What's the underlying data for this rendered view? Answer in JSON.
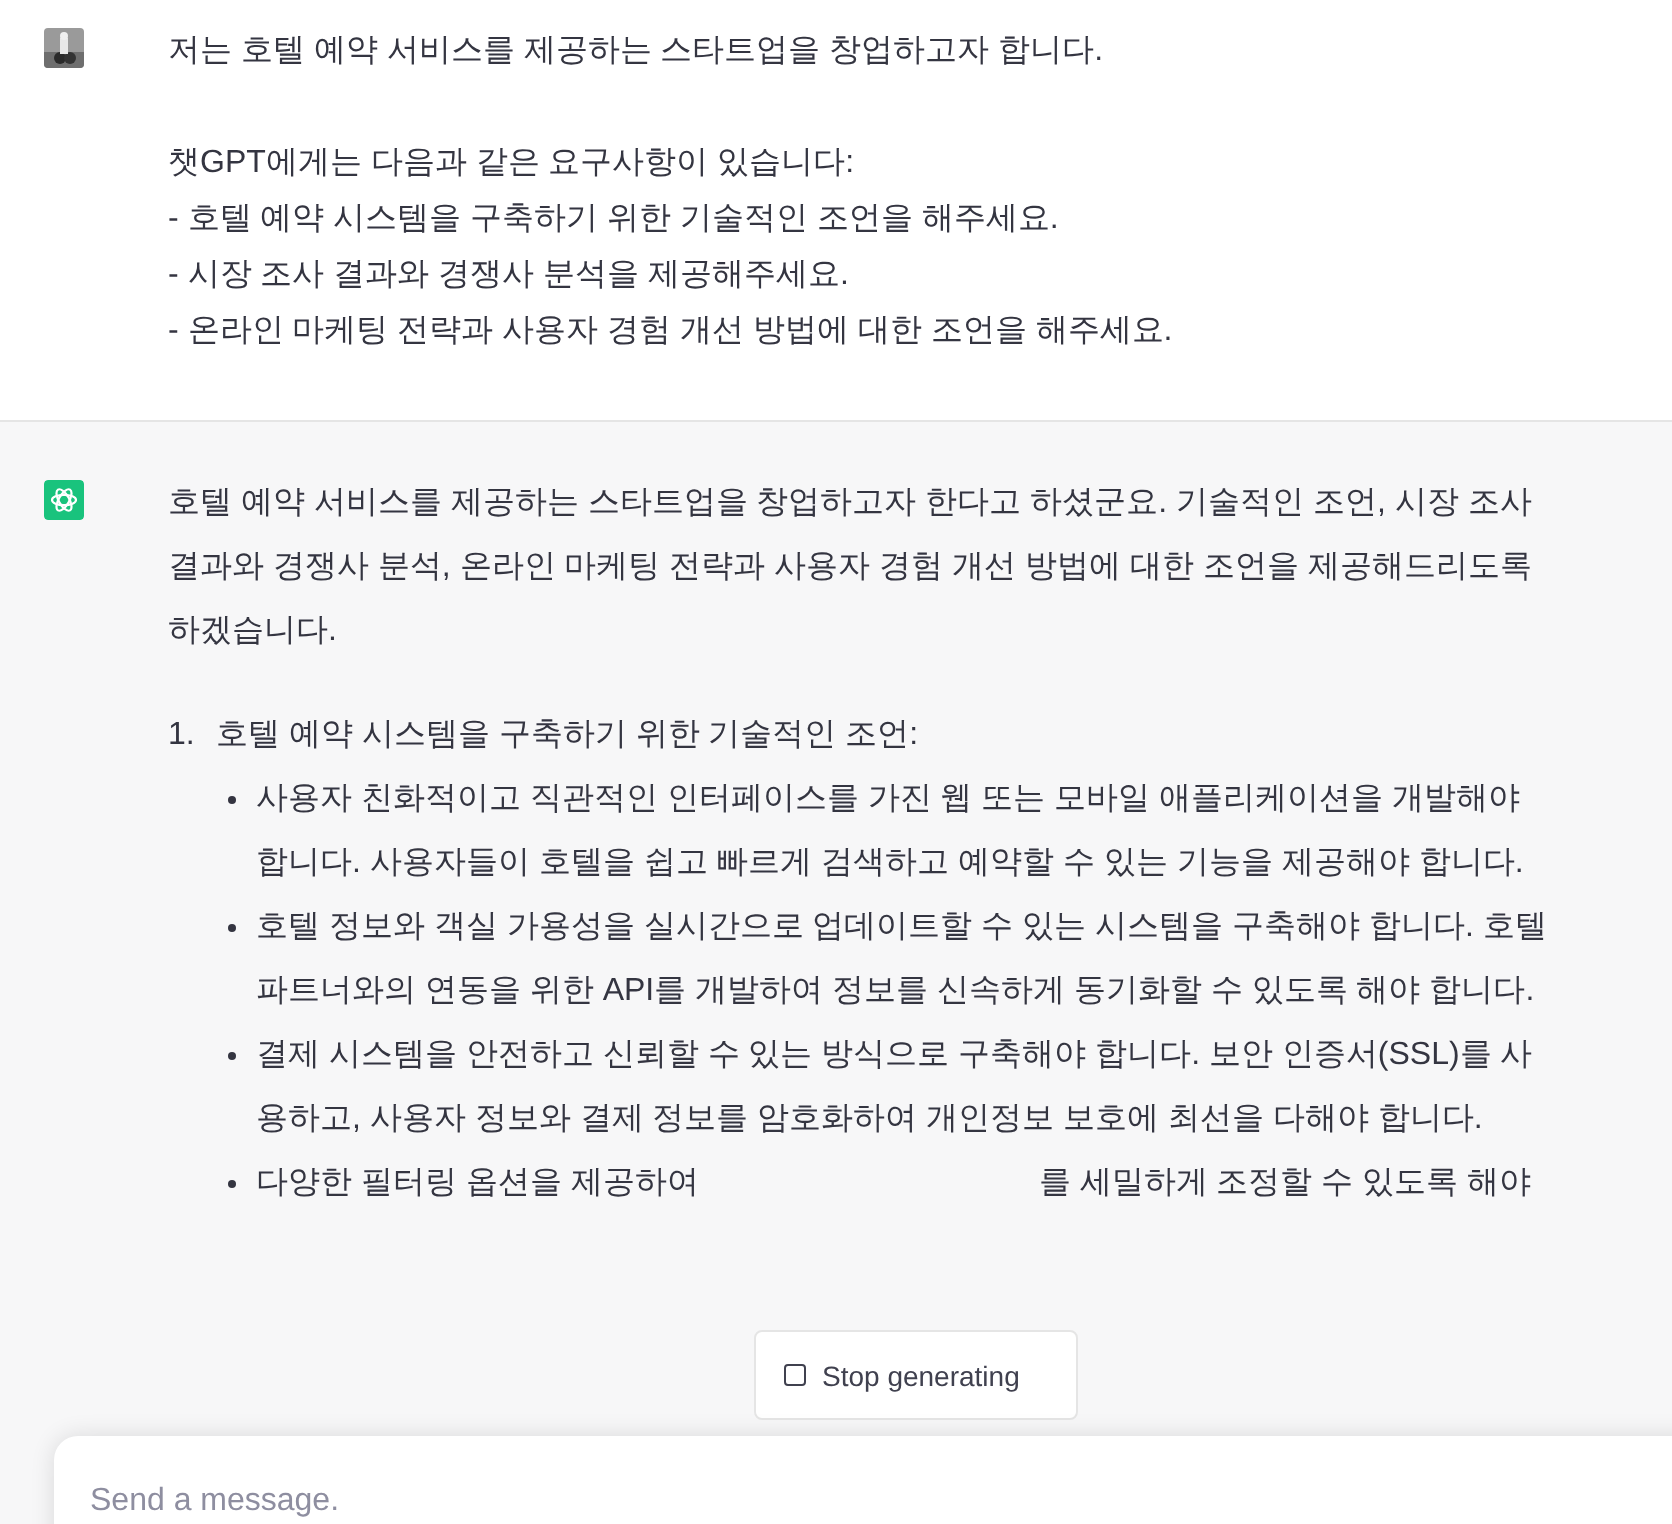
{
  "user_message": {
    "paragraphs": [
      [
        "저는 호텔 예약 서비스를 제공하는 스타트업을 창업하고자 합니다."
      ],
      [
        "챗GPT에게는 다음과 같은 요구사항이 있습니다:",
        "- 호텔 예약 시스템을 구축하기 위한 기술적인 조언을 해주세요.",
        "- 시장 조사 결과와 경쟁사 분석을 제공해주세요.",
        "- 온라인 마케팅 전략과 사용자 경험 개선 방법에 대한 조언을 해주세요."
      ]
    ]
  },
  "assistant_message": {
    "intro": "호텔 예약 서비스를 제공하는 스타트업을 창업하고자 한다고 하셨군요. 기술적인 조언, 시장 조사 결과와 경쟁사 분석, 온라인 마케팅 전략과 사용자 경험 개선 방법에 대한 조언을 제공해드리도록 하겠습니다.",
    "sections": [
      {
        "number": "1.",
        "title": "호텔 예약 시스템을 구축하기 위한 기술적인 조언:",
        "bullets": [
          {
            "text": "사용자 친화적이고 직관적인 인터페이스를 가진 웹 또는 모바일 애플리케이션을 개발해야 합니다. 사용자들이 호텔을 쉽고 빠르게 검색하고 예약할 수 있는 기능을 제공해야 합니다."
          },
          {
            "text": "호텔 정보와 객실 가용성을 실시간으로 업데이트할 수 있는 시스템을 구축해야 합니다. 호텔 파트너와의 연동을 위한 API를 개발하여 정보를 신속하게 동기화할 수 있도록 해야 합니다."
          },
          {
            "text": "결제 시스템을 안전하고 신뢰할 수 있는 방식으로 구축해야 합니다. 보안 인증서(SSL)를 사용하고, 사용자 정보와 결제 정보를 암호화하여 개인정보 보호에 최선을 다해야 합니다."
          },
          {
            "text": "다양한 필터링 옵션을 제공하여",
            "text_after": "를 세밀하게 조정할 수 있도록 해야"
          }
        ]
      }
    ]
  },
  "stop_button": {
    "label": "Stop generating"
  },
  "composer": {
    "placeholder": "Send a message."
  }
}
